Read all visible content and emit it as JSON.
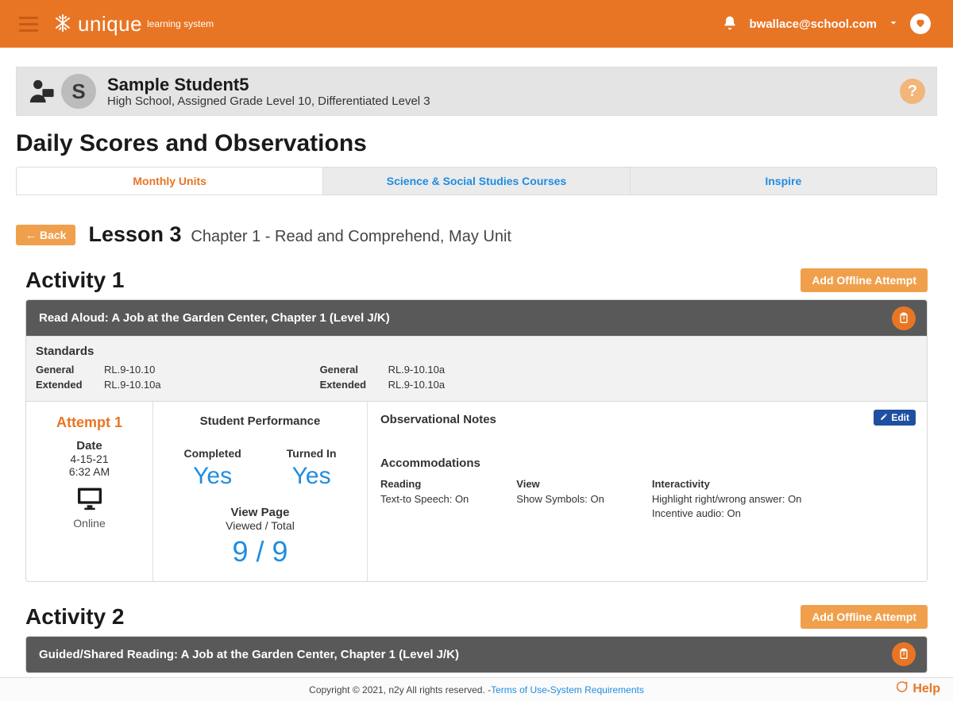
{
  "header": {
    "brand_main": "unique",
    "brand_sub": "learning system",
    "user_email": "bwallace@school.com"
  },
  "student": {
    "initial": "S",
    "name": "Sample Student5",
    "meta": "High School, Assigned Grade Level 10, Differentiated Level 3"
  },
  "page_title": "Daily Scores and Observations",
  "tabs": {
    "monthly": "Monthly Units",
    "science": "Science & Social Studies Courses",
    "inspire": "Inspire"
  },
  "lesson": {
    "back_label": "Back",
    "title": "Lesson 3",
    "subtitle": "Chapter 1 - Read and Comprehend, May Unit"
  },
  "add_attempt_label": "Add Offline Attempt",
  "activity1": {
    "title": "Activity 1",
    "bar_title": "Read Aloud: A Job at the Garden Center, Chapter 1 (Level J/K)",
    "standards_title": "Standards",
    "std_general_label": "General",
    "std_extended_label": "Extended",
    "std1_general": "RL.9-10.10",
    "std1_extended": "RL.9-10.10a",
    "std2_general": "RL.9-10.10a",
    "std2_extended": "RL.9-10.10a",
    "attempt": {
      "label": "Attempt 1",
      "date_label": "Date",
      "date": "4-15-21",
      "time": "6:32 AM",
      "mode": "Online"
    },
    "perf": {
      "title": "Student Performance",
      "completed_label": "Completed",
      "completed_val": "Yes",
      "turned_in_label": "Turned In",
      "turned_in_val": "Yes",
      "view_label": "View Page",
      "view_sub": "Viewed / Total",
      "score": "9 / 9"
    },
    "obs": {
      "title": "Observational Notes",
      "edit_label": "Edit",
      "accom_title": "Accommodations",
      "reading_h": "Reading",
      "reading_v": "Text-to Speech: On",
      "view_h": "View",
      "view_v": "Show Symbols: On",
      "inter_h": "Interactivity",
      "inter_v1": "Highlight right/wrong answer: On",
      "inter_v2": "Incentive audio: On"
    }
  },
  "activity2": {
    "title": "Activity 2",
    "bar_title": "Guided/Shared Reading: A Job at the Garden Center, Chapter 1 (Level J/K)"
  },
  "footer": {
    "copyright": "Copyright © 2021, n2y All rights reserved. - ",
    "terms": "Terms of Use",
    "dash": " - ",
    "sysreq": "System Requirements",
    "help": "Help"
  }
}
